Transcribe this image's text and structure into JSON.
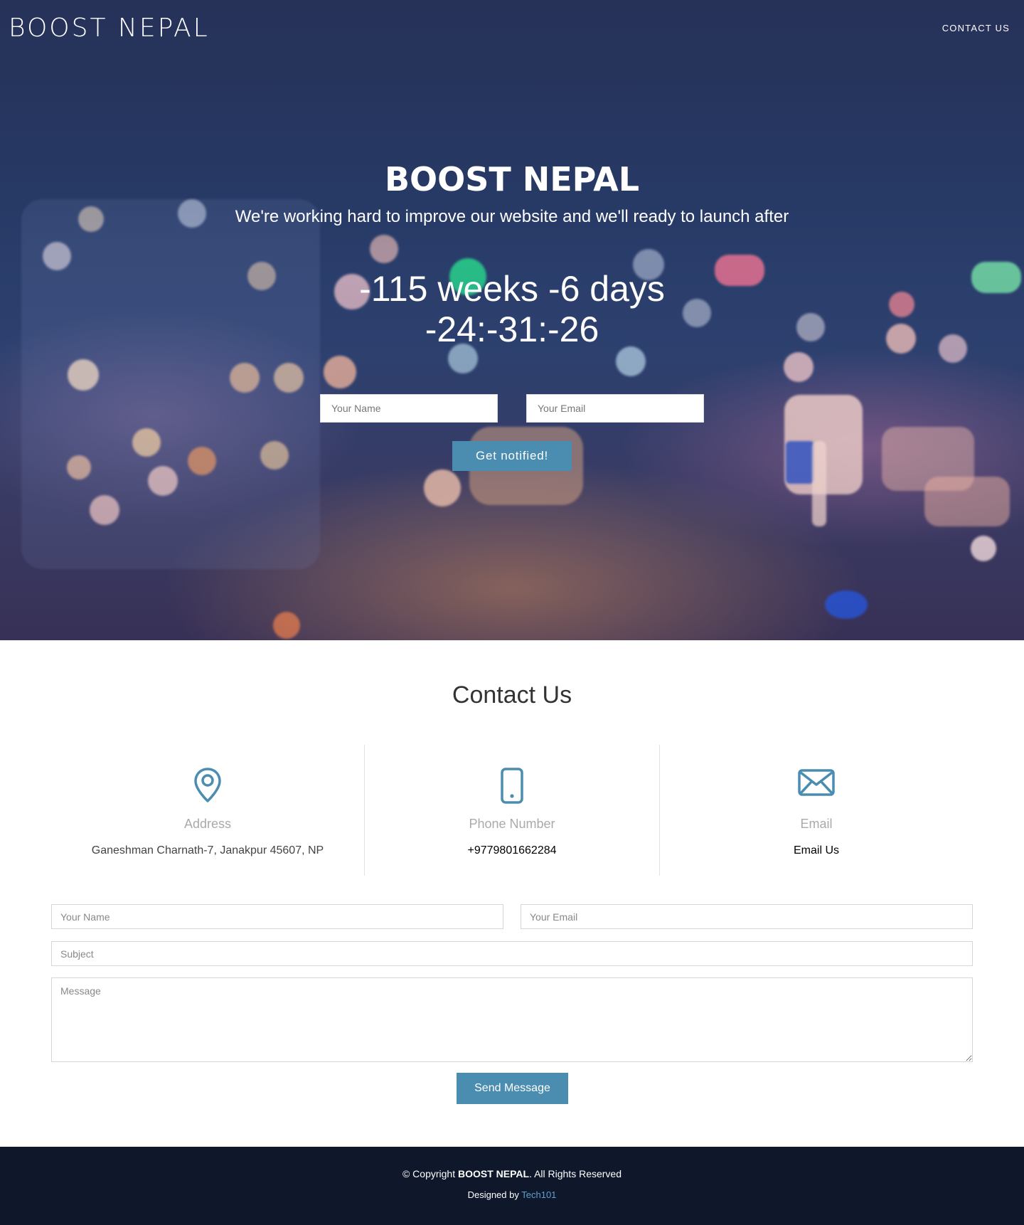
{
  "navbar": {
    "brand": "BOOST NEPAL",
    "contact_link": "CONTACT US"
  },
  "hero": {
    "title": "BOOST NEPAL",
    "subtitle": "We're working hard to improve our website and we'll ready to launch after",
    "countdown_line1": "-115 weeks -6 days",
    "countdown_line2": "-24:-31:-26",
    "name_placeholder": "Your Name",
    "email_placeholder": "Your Email",
    "notify_button": "Get notified!"
  },
  "contact": {
    "title": "Contact Us",
    "info": [
      {
        "icon": "map-pin-icon",
        "label": "Address",
        "value": "Ganeshman Charnath-7, Janakpur 45607, NP"
      },
      {
        "icon": "phone-icon",
        "label": "Phone Number",
        "value": "+9779801662284"
      },
      {
        "icon": "envelope-icon",
        "label": "Email",
        "value": "Email Us"
      }
    ],
    "form": {
      "name_placeholder": "Your Name",
      "email_placeholder": "Your Email",
      "subject_placeholder": "Subject",
      "message_placeholder": "Message",
      "send_button": "Send Message"
    }
  },
  "footer": {
    "copyright_prefix": "© Copyright ",
    "copyright_brand": "BOOST NEPAL",
    "copyright_suffix": ". All Rights Reserved",
    "designed_prefix": "Designed by ",
    "designed_link": "Tech101"
  },
  "colors": {
    "accent": "#4a8db0",
    "footer_bg": "#0f172b",
    "hero_bg": "#273a66"
  }
}
